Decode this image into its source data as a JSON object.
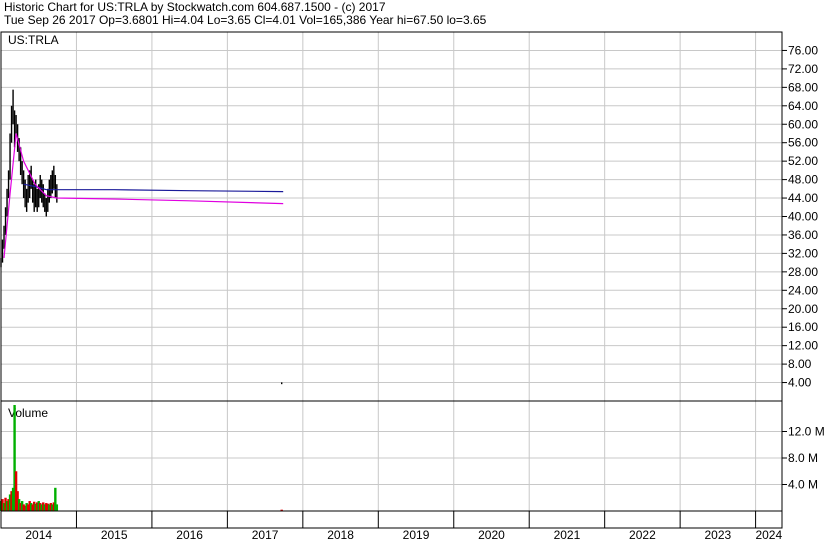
{
  "header": {
    "line1": "Historic Chart for US:TRLA by Stockwatch.com 604.687.1500 - (c) 2017",
    "line2": "Tue Sep 26 2017  Op=3.6801  Hi=4.04  Lo=3.65  Cl=4.01  Vol=165,386  Year hi=67.50  lo=3.65"
  },
  "colors": {
    "price_bars": "#000000",
    "ma_short": "#1a1a9a",
    "ma_long": "#e000e0",
    "vol_up": "#00b000",
    "vol_down": "#e00000",
    "grid": "#c8c8c8",
    "frame": "#000000"
  },
  "chart_data": [
    {
      "type": "line",
      "title": "US:TRLA",
      "xlabel": "",
      "ylabel": "",
      "ylim": [
        0,
        80
      ],
      "yticks": [
        "76.00",
        "72.00",
        "68.00",
        "64.00",
        "60.00",
        "56.00",
        "52.00",
        "48.00",
        "44.00",
        "40.00",
        "36.00",
        "32.00",
        "28.00",
        "24.00",
        "20.00",
        "16.00",
        "12.00",
        "8.00",
        "4.00"
      ],
      "xlim": [
        2014.0,
        2024.35
      ],
      "x_labels": [
        "2014",
        "2015",
        "2016",
        "2017",
        "2018",
        "2019",
        "2020",
        "2021",
        "2022",
        "2023",
        "2024"
      ],
      "grid": true,
      "series": [
        {
          "style": "ohlc",
          "points": [
            [
              2014.0,
              29,
              31
            ],
            [
              2014.02,
              30,
              35
            ],
            [
              2014.04,
              33,
              38
            ],
            [
              2014.06,
              36,
              42
            ],
            [
              2014.08,
              40,
              46
            ],
            [
              2014.1,
              44,
              50
            ],
            [
              2014.12,
              48,
              58
            ],
            [
              2014.14,
              56,
              64
            ],
            [
              2014.16,
              60,
              67.5
            ],
            [
              2014.18,
              55,
              63
            ],
            [
              2014.2,
              58,
              62
            ],
            [
              2014.22,
              54,
              60
            ],
            [
              2014.24,
              52,
              57
            ],
            [
              2014.26,
              49,
              55
            ],
            [
              2014.28,
              47,
              52
            ],
            [
              2014.3,
              44,
              50
            ],
            [
              2014.32,
              42,
              48
            ],
            [
              2014.34,
              41,
              46
            ],
            [
              2014.36,
              43,
              49
            ],
            [
              2014.38,
              44,
              50
            ],
            [
              2014.4,
              46,
              51
            ],
            [
              2014.42,
              43,
              48
            ],
            [
              2014.44,
              41,
              47
            ],
            [
              2014.46,
              42,
              48
            ],
            [
              2014.48,
              41,
              46
            ],
            [
              2014.5,
              42,
              47
            ],
            [
              2014.52,
              44,
              49
            ],
            [
              2014.54,
              43,
              48
            ],
            [
              2014.56,
              42,
              47
            ],
            [
              2014.58,
              41,
              45
            ],
            [
              2014.6,
              40,
              44
            ],
            [
              2014.62,
              41,
              46
            ],
            [
              2014.64,
              43,
              48
            ],
            [
              2014.66,
              44,
              49
            ],
            [
              2014.68,
              45,
              50
            ],
            [
              2014.7,
              46,
              51
            ],
            [
              2014.72,
              44,
              49
            ],
            [
              2014.74,
              43,
              47
            ]
          ]
        },
        {
          "name": "",
          "style": "ma_short",
          "points": [
            [
              2014.3,
              47
            ],
            [
              2014.45,
              46.5
            ],
            [
              2014.6,
              45.8
            ],
            [
              2014.74,
              45.8
            ],
            [
              2015.5,
              45.8
            ],
            [
              2016.5,
              45.6
            ],
            [
              2017.74,
              45.4
            ]
          ]
        },
        {
          "name": "",
          "style": "ma_long",
          "points": [
            [
              2014.04,
              31
            ],
            [
              2014.12,
              45
            ],
            [
              2014.2,
              58
            ],
            [
              2014.3,
              52
            ],
            [
              2014.45,
              47
            ],
            [
              2014.6,
              44.5
            ],
            [
              2014.74,
              44
            ],
            [
              2015.5,
              43.8
            ],
            [
              2016.5,
              43.4
            ],
            [
              2017.74,
              42.8
            ]
          ]
        },
        {
          "style": "ohlc",
          "points": [
            [
              2017.72,
              3.65,
              4.04
            ]
          ]
        }
      ]
    },
    {
      "type": "bar",
      "title": "Volume",
      "ylim": [
        0,
        16
      ],
      "unit": "M",
      "yticks": [
        "12.0 M",
        "8.0 M",
        "4.0 M"
      ],
      "grid": true,
      "bars": [
        [
          2014.0,
          1.5,
          "up"
        ],
        [
          2014.02,
          1.8,
          "down"
        ],
        [
          2014.04,
          1.2,
          "up"
        ],
        [
          2014.06,
          2.0,
          "down"
        ],
        [
          2014.08,
          1.5,
          "up"
        ],
        [
          2014.1,
          1.8,
          "down"
        ],
        [
          2014.12,
          2.5,
          "up"
        ],
        [
          2014.14,
          3.0,
          "down"
        ],
        [
          2014.16,
          3.5,
          "up"
        ],
        [
          2014.18,
          16,
          "up"
        ],
        [
          2014.2,
          6.0,
          "down"
        ],
        [
          2014.22,
          3.0,
          "down"
        ],
        [
          2014.24,
          1.8,
          "up"
        ],
        [
          2014.26,
          1.2,
          "down"
        ],
        [
          2014.28,
          1.5,
          "up"
        ],
        [
          2014.3,
          1.0,
          "down"
        ],
        [
          2014.32,
          0.8,
          "down"
        ],
        [
          2014.34,
          1.2,
          "up"
        ],
        [
          2014.36,
          1.0,
          "down"
        ],
        [
          2014.38,
          1.5,
          "down"
        ],
        [
          2014.4,
          1.2,
          "up"
        ],
        [
          2014.42,
          1.0,
          "down"
        ],
        [
          2014.44,
          1.4,
          "down"
        ],
        [
          2014.46,
          1.1,
          "up"
        ],
        [
          2014.48,
          1.3,
          "down"
        ],
        [
          2014.5,
          1.5,
          "up"
        ],
        [
          2014.52,
          1.2,
          "down"
        ],
        [
          2014.54,
          1.0,
          "up"
        ],
        [
          2014.56,
          1.3,
          "down"
        ],
        [
          2014.58,
          1.0,
          "up"
        ],
        [
          2014.6,
          1.2,
          "down"
        ],
        [
          2014.62,
          1.1,
          "down"
        ],
        [
          2014.64,
          1.0,
          "up"
        ],
        [
          2014.66,
          1.2,
          "down"
        ],
        [
          2014.68,
          1.0,
          "up"
        ],
        [
          2014.7,
          1.3,
          "down"
        ],
        [
          2014.72,
          3.5,
          "up"
        ],
        [
          2014.74,
          1.0,
          "up"
        ],
        [
          2017.72,
          0.2,
          "down"
        ]
      ]
    }
  ]
}
